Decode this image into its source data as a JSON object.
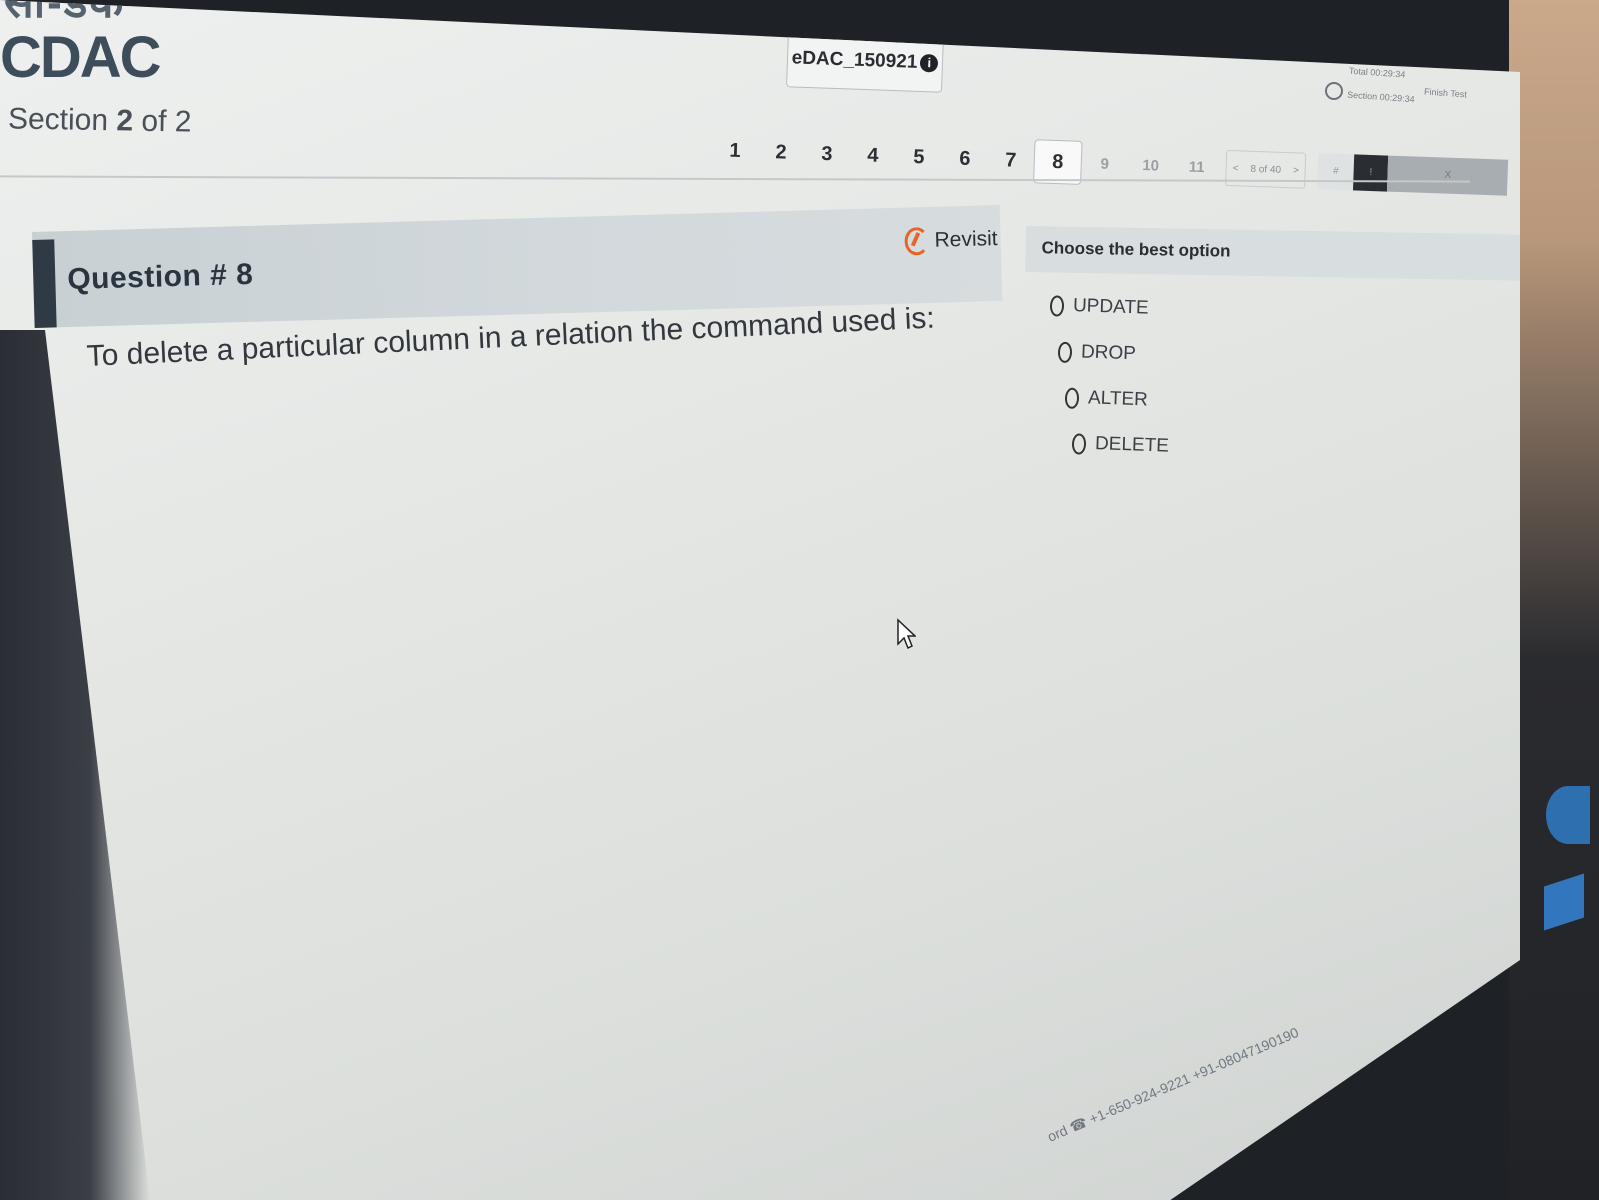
{
  "brand": {
    "logo_top": "सी-डैक",
    "logo_main": "CDAC"
  },
  "section": {
    "prefix": "Section",
    "current": "2",
    "of_text": "of 2"
  },
  "exam": {
    "id": "eDAC_150921",
    "info_icon": "i"
  },
  "timer_meta": {
    "line1": "Total 00:29:34",
    "line2": "Section 00:29:34",
    "finish": "Finish Test"
  },
  "question_nav": {
    "numbers": [
      "1",
      "2",
      "3",
      "4",
      "5",
      "6",
      "7",
      "8",
      "9",
      "10",
      "11"
    ],
    "current": "8",
    "pager": {
      "prev": "<",
      "label": "8 of 40",
      "next": ">"
    },
    "tools": [
      "#",
      "!",
      "X"
    ]
  },
  "question": {
    "title": "Question # 8",
    "text": "To delete a particular column in a relation the command used is:",
    "revisit_label": "Revisit"
  },
  "options": {
    "heading": "Choose the best option",
    "items": [
      "UPDATE",
      "DROP",
      "ALTER",
      "DELETE"
    ],
    "selected": null
  },
  "footer": {
    "contact": "ord ☎ +1-650-924-9221  +91-08047190190"
  }
}
